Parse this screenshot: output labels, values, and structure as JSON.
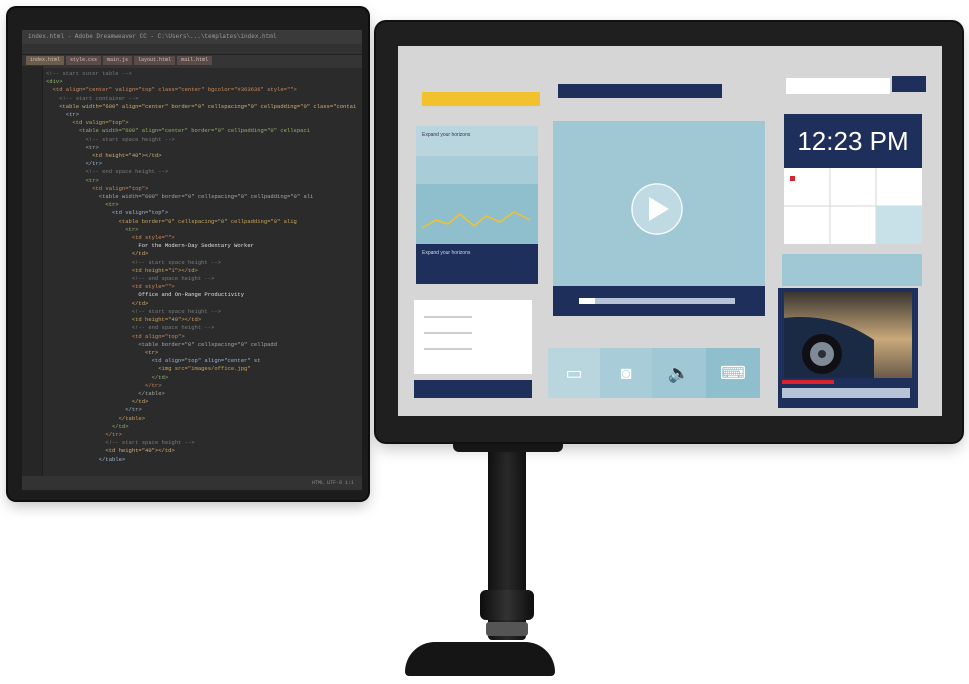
{
  "left_monitor": {
    "editor_title": "index.html - Adobe Dreamweaver CC - C:\\Users\\...\\templates\\index.html",
    "tabs": [
      "index.html",
      "style.css",
      "main.js",
      "layout.html",
      "mail.html"
    ],
    "code_lines": [
      "<!-- start outer table -->",
      "<div>",
      "  <td align=\"center\" valign=\"top\" class=\"center\" bgcolor=\"#363636\" style=\"\">",
      "    <!-- start container -->",
      "    <table width=\"600\" align=\"center\" border=\"0\" cellspacing=\"0\" cellpadding=\"0\" class=\"contai",
      "      <tr>",
      "        <td valign=\"top\">",
      "          <table width=\"600\" align=\"center\" border=\"0\" cellpadding=\"0\" cellspaci",
      "            <!-- start space height -->",
      "            <tr>",
      "              <td height=\"40\"></td>",
      "            </tr>",
      "            <!-- end space height -->",
      "            <tr>",
      "              <td valign=\"top\">",
      "                <table width=\"600\" border=\"0\" cellspacing=\"0\" cellpadding=\"0\" ali",
      "                  <tr>",
      "                    <td valign=\"top\">",
      "                      <table border=\"0\" cellspacing=\"0\" cellpadding=\"0\" alig",
      "                        <tr>",
      "                          <td style=\"\">",
      "                            For the Modern-Day Sedentary Worker",
      "                          </td>",
      "                          <!-- start space height -->",
      "                          <td height=\"1\"></td>",
      "                          <!-- end space height -->",
      "                          <td style=\"\">",
      "                            Office and On-Range Productivity",
      "                          </td>",
      "                          <!-- start space height -->",
      "                          <td height=\"40\"></td>",
      "                          <!-- end space height -->",
      "                          <td align=\"top\">",
      "                            <table border=\"0\" cellspacing=\"0\" cellpadd",
      "                              <tr>",
      "                                <td align=\"top\" align=\"center\" st",
      "                                  <img src=\"images/office.jpg\"",
      "                                </td>",
      "                              </tr>",
      "                            </table>",
      "                          </td>",
      "                        </tr>",
      "                      </table>",
      "                    </td>",
      "                  </tr>",
      "                  <!-- start space height -->",
      "                  <td height=\"40\"></td>",
      "                </table>"
    ],
    "status_text": "HTML  UTF-8  1:1"
  },
  "right_monitor": {
    "clock_time": "12:23 PM",
    "left_panel_label_top": "Expand your horizons",
    "left_panel_label_bottom": "Expand your horizons",
    "progress": 0.1,
    "colors": {
      "navy": "#1e2f5b",
      "sky": "#9fc7d4",
      "sky_light": "#b9d6df",
      "yellow": "#f2c22e",
      "white": "#ffffff",
      "red": "#d9232e",
      "screen_bg": "#d6d6d6"
    },
    "icons": [
      "monitor-icon",
      "camera-icon",
      "speaker-icon",
      "keyboard-icon"
    ]
  }
}
